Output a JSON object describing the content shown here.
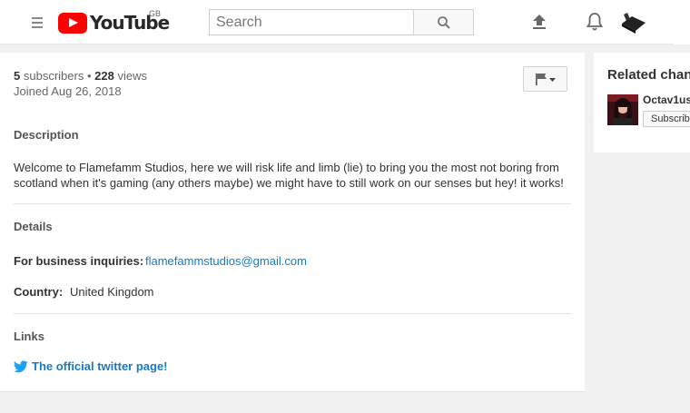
{
  "header": {
    "logo_text": "YouTube",
    "logo_country": "GB",
    "search_placeholder": "Search",
    "icons": [
      "menu-icon",
      "search-icon",
      "upload-icon",
      "bell-icon",
      "avatar"
    ]
  },
  "about": {
    "subscribers": "5",
    "subscribers_label": "subscribers",
    "separator": "•",
    "views": "228",
    "views_label": "views",
    "joined": "Joined Aug 26, 2018",
    "description_title": "Description",
    "description": "Welcome to Flamefamm Studios, here we will risk life and limb (lie) to bring you the most not boring from scotland when it's gaming (any others maybe) we might have to still work on our senses but hey! it works!",
    "details_title": "Details",
    "business_label": "For business inquiries:",
    "business_email": "flamefammstudios@gmail.com",
    "country_label": "Country:",
    "country_value": "United Kingdom",
    "links_title": "Links",
    "twitter_link": "The official twitter page!"
  },
  "related": {
    "title": "Related chann",
    "channel_name": "Octav1us",
    "subscribe_label": "Subscrib"
  },
  "colors": {
    "brand_red": "#ff0000",
    "link_blue": "#167ac6",
    "twitter_blue": "#1da1f2",
    "background": "#f1f1f1"
  }
}
